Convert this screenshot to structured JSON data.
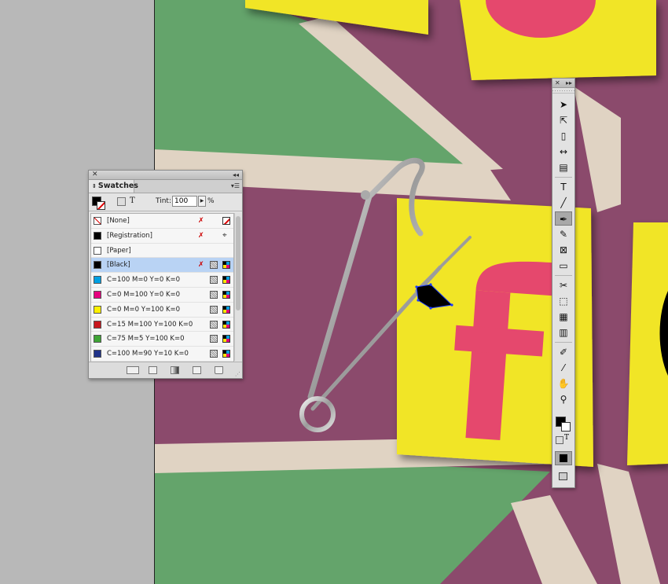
{
  "poster": {
    "letter": "f"
  },
  "swatches_panel": {
    "close_glyph": "✕",
    "collapse_glyph": "◂◂",
    "tab_label": "Swatches",
    "menu_glyph": "▾☰",
    "tint_label": "Tint:",
    "tint_value": "100",
    "tint_arrow": "▶",
    "tint_unit": "%",
    "text_icon": "T",
    "swatches": [
      {
        "name": "[None]",
        "color": "#ffffff",
        "kind": "none"
      },
      {
        "name": "[Registration]",
        "color": "#000000",
        "kind": "registration"
      },
      {
        "name": "[Paper]",
        "color": "#ffffff",
        "kind": "paper"
      },
      {
        "name": "[Black]",
        "color": "#000000",
        "kind": "black"
      },
      {
        "name": "C=100 M=0 Y=0 K=0",
        "color": "#00a0e3",
        "kind": "process"
      },
      {
        "name": "C=0 M=100 Y=0 K=0",
        "color": "#e5007e",
        "kind": "process"
      },
      {
        "name": "C=0 M=0 Y=100 K=0",
        "color": "#fff100",
        "kind": "process"
      },
      {
        "name": "C=15 M=100 Y=100 K=0",
        "color": "#c8171e",
        "kind": "process"
      },
      {
        "name": "C=75 M=5 Y=100 K=0",
        "color": "#3fa535",
        "kind": "process"
      },
      {
        "name": "C=100 M=90 Y=10 K=0",
        "color": "#20338a",
        "kind": "process"
      }
    ],
    "selected_index": 3
  },
  "tools_panel": {
    "close_glyph": "✕",
    "expand_glyph": "▸▸",
    "tools": [
      {
        "icon": "selection-arrow-icon",
        "glyph": "➤"
      },
      {
        "icon": "direct-selection-icon",
        "glyph": "⇱"
      },
      {
        "icon": "page-tool-icon",
        "glyph": "▯"
      },
      {
        "icon": "gap-tool-icon",
        "glyph": "↔"
      },
      {
        "icon": "content-collector-icon",
        "glyph": "▤"
      },
      {
        "icon": "type-tool-icon",
        "glyph": "T"
      },
      {
        "icon": "line-tool-icon",
        "glyph": "╱"
      },
      {
        "icon": "pen-tool-icon",
        "glyph": "✒"
      },
      {
        "icon": "pencil-tool-icon",
        "glyph": "✎"
      },
      {
        "icon": "rectangle-frame-icon",
        "glyph": "⊠"
      },
      {
        "icon": "rectangle-tool-icon",
        "glyph": "▭"
      },
      {
        "icon": "scissors-icon",
        "glyph": "✂"
      },
      {
        "icon": "free-transform-icon",
        "glyph": "⬚"
      },
      {
        "icon": "gradient-swatch-icon",
        "glyph": "▦"
      },
      {
        "icon": "gradient-feather-icon",
        "glyph": "▥"
      },
      {
        "icon": "note-tool-icon",
        "glyph": "✐"
      },
      {
        "icon": "eyedropper-icon",
        "glyph": "⁄"
      },
      {
        "icon": "hand-tool-icon",
        "glyph": "✋"
      },
      {
        "icon": "zoom-tool-icon",
        "glyph": "⚲"
      }
    ],
    "active_tool": "pen-tool-icon",
    "text_icon": "T"
  },
  "colors": {
    "pasteboard": "#b8b8b8",
    "purple": "#8b4a6c",
    "green": "#64a46b",
    "beige": "#e0d3c3",
    "yellow": "#f1e526",
    "pink": "#e5486d"
  }
}
